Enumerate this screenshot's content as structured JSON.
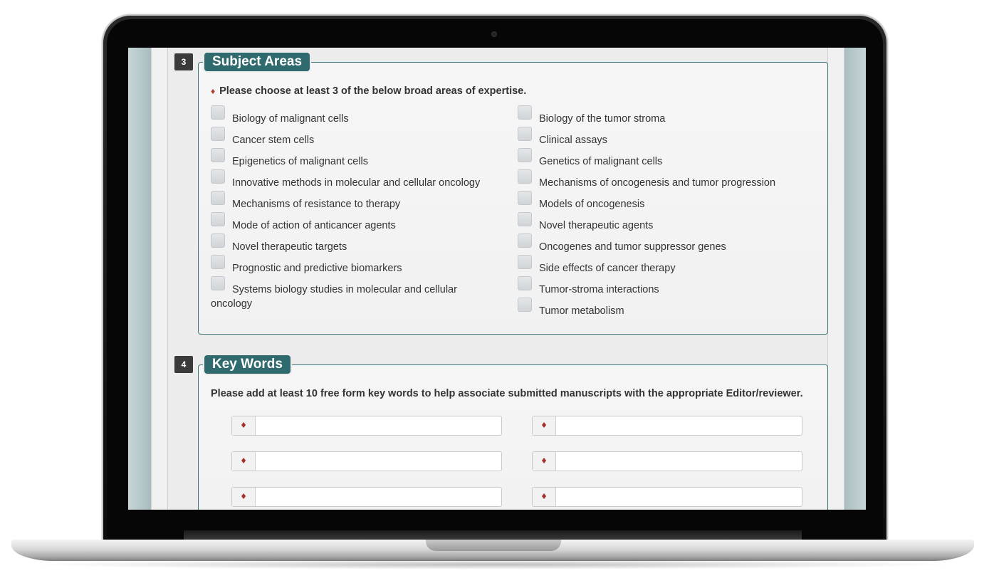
{
  "section3": {
    "number": "3",
    "title": "Subject Areas",
    "required_marker": "♦",
    "instruction": "Please choose at least 3 of the below broad areas of expertise.",
    "left_options": [
      "Biology of malignant cells",
      "Cancer stem cells",
      "Epigenetics of malignant cells",
      "Innovative methods in molecular and cellular oncology",
      "Mechanisms of resistance to therapy",
      "Mode of action of anticancer agents",
      "Novel therapeutic targets",
      "Prognostic and predictive biomarkers",
      "Systems biology studies in molecular and cellular oncology"
    ],
    "right_options": [
      "Biology of the tumor stroma",
      "Clinical assays",
      "Genetics of malignant cells",
      "Mechanisms of oncogenesis and tumor progression",
      "Models of oncogenesis",
      "Novel therapeutic agents",
      "Oncogenes and tumor suppressor genes",
      "Side effects of cancer therapy",
      "Tumor-stroma interactions",
      "Tumor metabolism"
    ]
  },
  "section4": {
    "number": "4",
    "title": "Key Words",
    "instruction": "Please add at least 10 free form key words to help associate submitted manuscripts with the appropriate Editor/reviewer.",
    "required_marker": "♦",
    "keyword_values": [
      "",
      "",
      "",
      "",
      "",
      ""
    ]
  },
  "colors": {
    "accent": "#2f6a6f",
    "required": "#b03a2e",
    "badge": "#3b3b3b"
  }
}
